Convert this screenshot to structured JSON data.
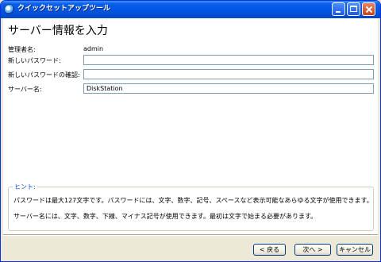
{
  "window": {
    "title": "クイックセットアップツール"
  },
  "page": {
    "title": "サーバー情報を入力"
  },
  "form": {
    "admin_label": "管理者名:",
    "admin_value": "admin",
    "new_password_label": "新しいパスワード:",
    "new_password_value": "",
    "confirm_password_label": "新しいパスワードの確認:",
    "confirm_password_value": "",
    "server_name_label": "サーバー名:",
    "server_name_value": "DiskStation"
  },
  "hint": {
    "title": "ヒント:",
    "line1": "パスワードは最大127文字です。パスワードには、文字、数字、記号、スペースなど表示可能なあらゆる文字が使用できます。",
    "line2": "サーバー名には、文字、数字、下線、マイナス記号が使用できます。最初は文字で始まる必要があります。"
  },
  "buttons": {
    "back": "< 戻る",
    "next": "次へ >",
    "cancel": "キャンセル"
  },
  "icons": {
    "app": "app-icon",
    "minimize": "minimize-icon",
    "maximize": "maximize-icon",
    "close": "close-icon"
  }
}
